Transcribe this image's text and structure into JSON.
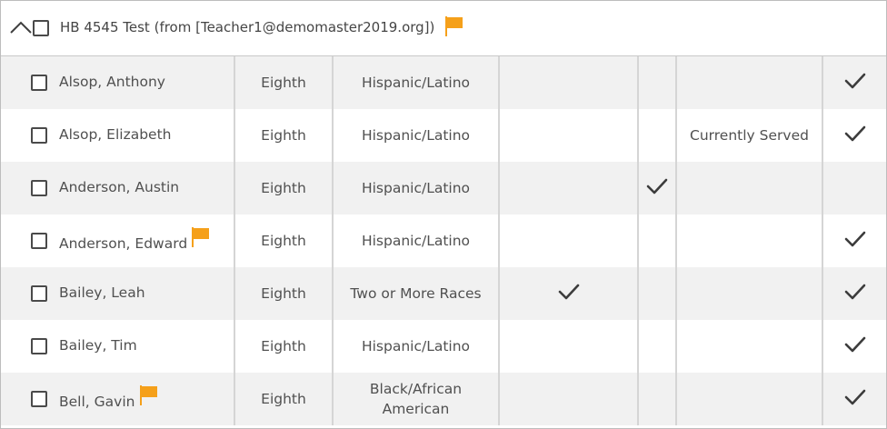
{
  "group": {
    "title": "HB 4545 Test (from [Teacher1@demomaster2019.org])",
    "flag_color": "#f5a01a"
  },
  "rows": [
    {
      "name": "Alsop, Anthony",
      "grade": "Eighth",
      "ethnicity": "Hispanic/Latino",
      "col4_checked": false,
      "col5_checked": false,
      "status": "",
      "col7_checked": true,
      "flagged": false
    },
    {
      "name": "Alsop, Elizabeth",
      "grade": "Eighth",
      "ethnicity": "Hispanic/Latino",
      "col4_checked": false,
      "col5_checked": false,
      "status": "Currently Served",
      "col7_checked": true,
      "flagged": false
    },
    {
      "name": "Anderson, Austin",
      "grade": "Eighth",
      "ethnicity": "Hispanic/Latino",
      "col4_checked": false,
      "col5_checked": true,
      "status": "",
      "col7_checked": false,
      "flagged": false
    },
    {
      "name": "Anderson, Edward",
      "grade": "Eighth",
      "ethnicity": "Hispanic/Latino",
      "col4_checked": false,
      "col5_checked": false,
      "status": "",
      "col7_checked": true,
      "flagged": true
    },
    {
      "name": "Bailey, Leah",
      "grade": "Eighth",
      "ethnicity": "Two or More Races",
      "col4_checked": true,
      "col5_checked": false,
      "status": "",
      "col7_checked": true,
      "flagged": false
    },
    {
      "name": "Bailey, Tim",
      "grade": "Eighth",
      "ethnicity": "Hispanic/Latino",
      "col4_checked": false,
      "col5_checked": false,
      "status": "",
      "col7_checked": true,
      "flagged": false
    },
    {
      "name": "Bell, Gavin",
      "grade": "Eighth",
      "ethnicity_line1": "Black/African",
      "ethnicity_line2": "American",
      "col4_checked": false,
      "col5_checked": false,
      "status": "",
      "col7_checked": true,
      "flagged": true
    }
  ],
  "icons": {
    "collapse": "chevron-up-icon",
    "checkbox": "checkbox-icon",
    "flag": "flag-icon",
    "check": "checkmark-icon"
  },
  "colors": {
    "flag": "#f5a01a",
    "row_alt": "#f1f1f1",
    "text": "#505050"
  }
}
